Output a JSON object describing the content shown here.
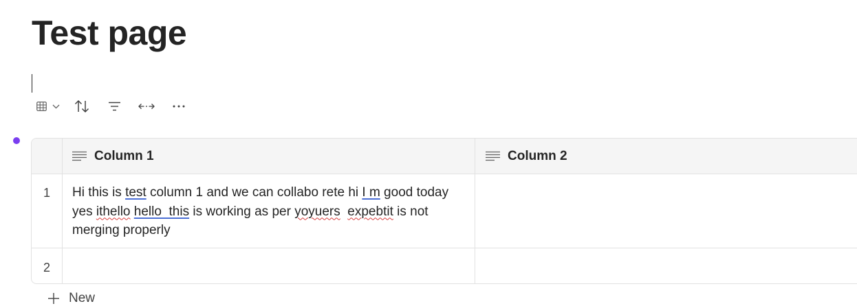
{
  "page": {
    "title": "Test page"
  },
  "toolbar": {
    "items": [
      {
        "name": "table-view-icon"
      },
      {
        "name": "chevron-down-icon"
      },
      {
        "name": "sort-icon"
      },
      {
        "name": "filter-icon"
      },
      {
        "name": "expand-width-icon"
      },
      {
        "name": "more-options-icon"
      }
    ]
  },
  "table": {
    "columns": [
      {
        "label": "Column 1",
        "icon": "text-lines-icon"
      },
      {
        "label": "Column 2",
        "icon": "text-lines-icon"
      }
    ],
    "rows": [
      {
        "number": "1",
        "cell1": {
          "segments": [
            {
              "t": "Hi this is ",
              "s": ""
            },
            {
              "t": "test",
              "s": "blue"
            },
            {
              "t": " column 1 and we can collabo rete hi ",
              "s": ""
            },
            {
              "t": "I m",
              "s": "blue"
            },
            {
              "t": " good today yes ",
              "s": ""
            },
            {
              "t": "ithello",
              "s": "red"
            },
            {
              "t": " ",
              "s": ""
            },
            {
              "t": "hello  this",
              "s": "blue"
            },
            {
              "t": " is working as per ",
              "s": ""
            },
            {
              "t": "yoyuers",
              "s": "red"
            },
            {
              "t": "  ",
              "s": ""
            },
            {
              "t": "expebtit",
              "s": "red"
            },
            {
              "t": " is not merging properly",
              "s": ""
            }
          ]
        },
        "cell2": ""
      },
      {
        "number": "2",
        "cell1": {
          "segments": []
        },
        "cell2": ""
      }
    ],
    "new_label": "New"
  },
  "colors": {
    "accent_dot": "#7a3ef0",
    "spell_error": "#d83b3b",
    "grammar_hint": "#4b6fd6"
  }
}
